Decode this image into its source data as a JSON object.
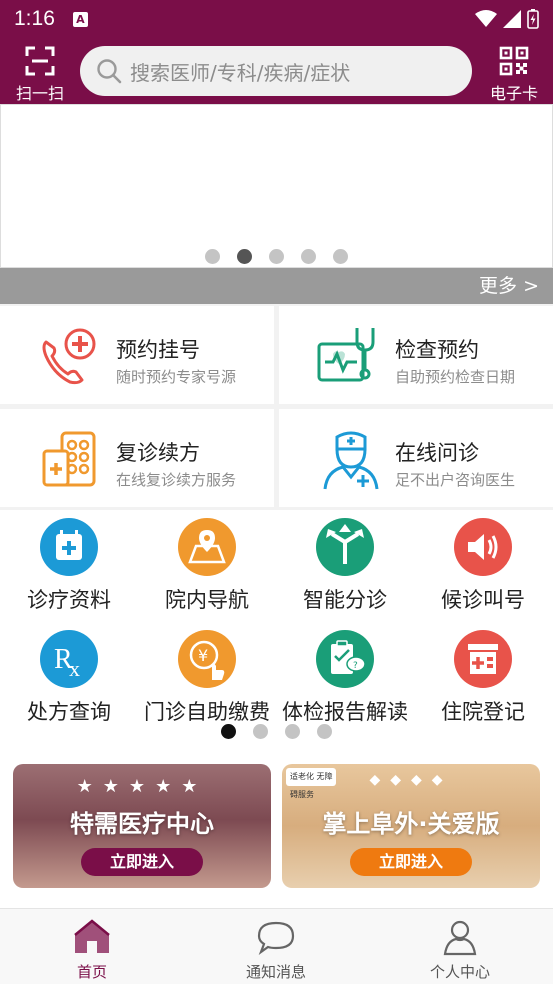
{
  "status_bar": {
    "time": "1:16"
  },
  "header": {
    "scan_label": "扫一扫",
    "search_placeholder": "搜索医师/专科/疾病/症状",
    "ecard_label": "电子卡"
  },
  "banner": {
    "active_dot": 1,
    "dot_count": 5,
    "more_label": "更多 >"
  },
  "services": [
    {
      "title": "预约挂号",
      "subtitle": "随时预约专家号源",
      "icon": "phone-cross-icon"
    },
    {
      "title": "检查预约",
      "subtitle": "自助预约检查日期",
      "icon": "monitor-stethoscope-icon"
    },
    {
      "title": "复诊续方",
      "subtitle": "在线复诊续方服务",
      "icon": "pill-box-icon"
    },
    {
      "title": "在线问诊",
      "subtitle": "足不出户咨询医生",
      "icon": "nurse-icon"
    }
  ],
  "grid": [
    {
      "label": "诊疗资料",
      "icon": "calendar-cross-icon",
      "color": "#1c9ad6"
    },
    {
      "label": "院内导航",
      "icon": "map-pin-icon",
      "color": "#f0992e"
    },
    {
      "label": "智能分诊",
      "icon": "split-arrows-icon",
      "color": "#1a9e78"
    },
    {
      "label": "候诊叫号",
      "icon": "speaker-icon",
      "color": "#e8534a"
    },
    {
      "label": "处方查询",
      "icon": "rx-icon",
      "color": "#1c9ad6"
    },
    {
      "label": "门诊自助缴费",
      "icon": "yen-hand-icon",
      "color": "#f0992e"
    },
    {
      "label": "体检报告解读",
      "icon": "clipboard-chat-icon",
      "color": "#1a9e78"
    },
    {
      "label": "住院登记",
      "icon": "hospital-icon",
      "color": "#e8534a"
    }
  ],
  "grid_pager": {
    "active_dot": 0,
    "dot_count": 4
  },
  "promos": [
    {
      "title": "特需医疗中心",
      "button": "立即进入",
      "stars": "★★★★★"
    },
    {
      "title": "掌上阜外·关爱版",
      "button": "立即进入",
      "badge": "适老化 无障碍服务",
      "ornament": "◆◆◆◆"
    }
  ],
  "bottom_nav": [
    {
      "label": "首页",
      "icon": "home-icon",
      "active": true
    },
    {
      "label": "通知消息",
      "icon": "chat-bubble-icon",
      "active": false
    },
    {
      "label": "个人中心",
      "icon": "user-icon",
      "active": false
    }
  ],
  "colors": {
    "brand": "#7a0e48",
    "blue": "#1c9ad6",
    "orange": "#f0992e",
    "green": "#1a9e78",
    "red": "#e8534a"
  }
}
